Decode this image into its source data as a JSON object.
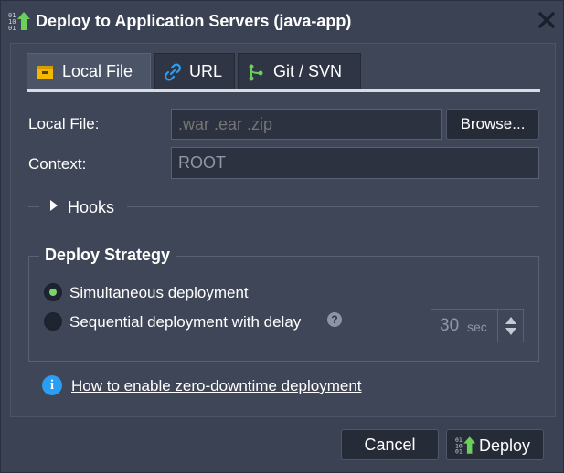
{
  "dialog": {
    "title": "Deploy to Application Servers (java-app)",
    "title_icon": "deploy-upload-icon",
    "close_icon": "close-icon"
  },
  "tabs": [
    {
      "label": "Local File",
      "icon": "archive-box-icon",
      "active": true
    },
    {
      "label": "URL",
      "icon": "link-icon",
      "active": false
    },
    {
      "label": "Git / SVN",
      "icon": "git-branch-icon",
      "active": false
    }
  ],
  "form": {
    "local_file_label": "Local File:",
    "local_file_placeholder": ".war .ear .zip",
    "browse_label": "Browse...",
    "context_label": "Context:",
    "context_value": "ROOT",
    "hooks_label": "Hooks"
  },
  "strategy": {
    "legend": "Deploy Strategy",
    "options": [
      {
        "label": "Simultaneous deployment",
        "selected": true
      },
      {
        "label": "Sequential deployment with delay",
        "selected": false
      }
    ],
    "help_glyph": "?",
    "delay_value": "30",
    "delay_unit": "sec"
  },
  "info": {
    "icon_glyph": "i",
    "link_text": "How to enable zero-downtime deployment"
  },
  "footer": {
    "cancel_label": "Cancel",
    "deploy_label": "Deploy"
  },
  "colors": {
    "background": "#3b4253",
    "accent_green": "#7bd36a",
    "info_blue": "#2a9df4",
    "tab_icon_yellow": "#f5b800"
  }
}
